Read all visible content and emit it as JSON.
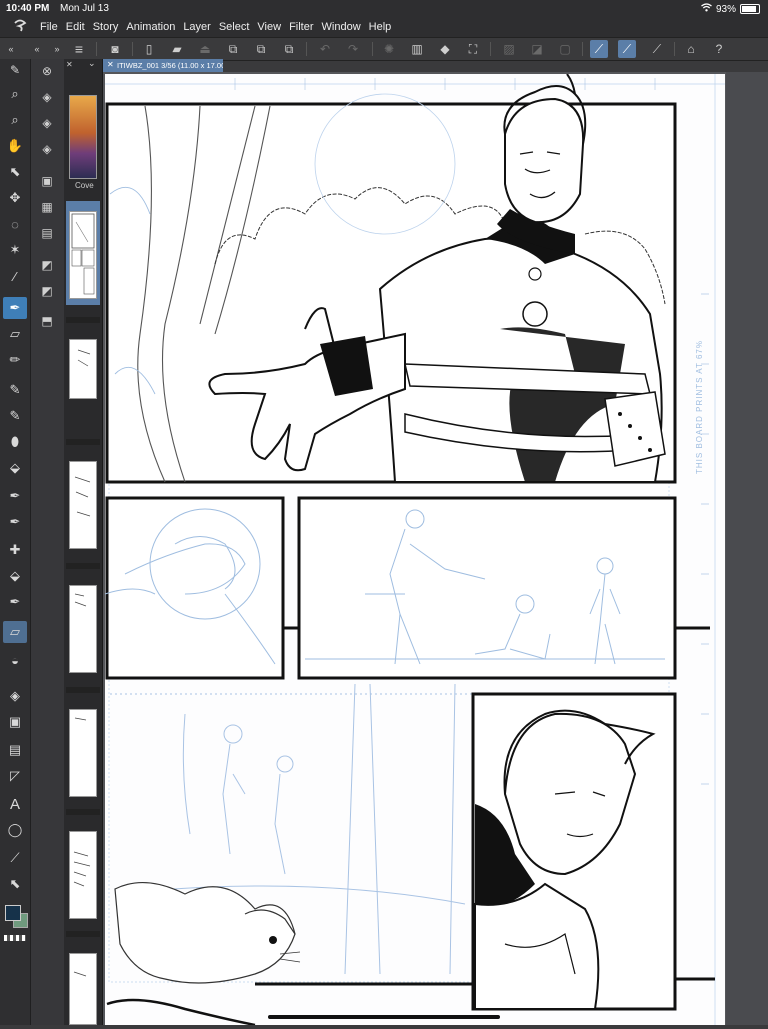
{
  "status_bar": {
    "time": "10:40 PM",
    "date": "Mon Jul 13",
    "battery": "93%"
  },
  "menu": {
    "items": [
      "File",
      "Edit",
      "Story",
      "Animation",
      "Layer",
      "Select",
      "View",
      "Filter",
      "Window",
      "Help"
    ]
  },
  "document_tab": {
    "title": "ITIWBZ_001 3/56 (11.00 x 17.00in 600dpi 27.5%)"
  },
  "page_panel": {
    "cover_label": "Cove"
  },
  "canvas": {
    "margin_note": "THIS BOARD PRINTS AT 67%"
  },
  "colors": {
    "accent": "#3f7fb8",
    "sketch_blue": "#9fbde0",
    "ink": "#111111"
  }
}
